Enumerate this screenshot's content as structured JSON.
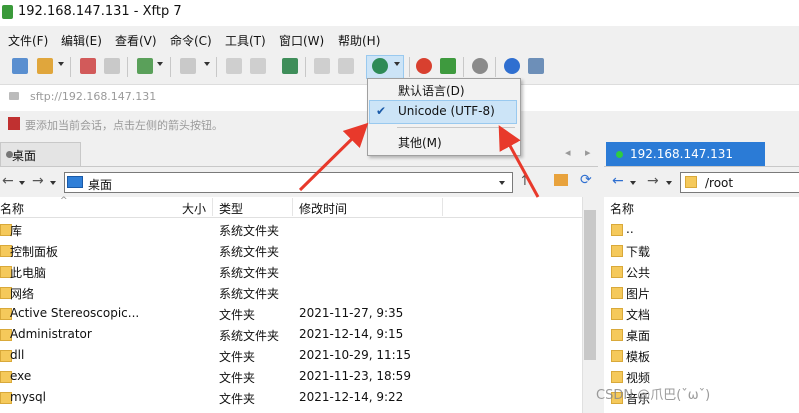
{
  "window": {
    "title": "192.168.147.131 - Xftp 7"
  },
  "menu": [
    "文件(F)",
    "编辑(E)",
    "查看(V)",
    "命令(C)",
    "工具(T)",
    "窗口(W)",
    "帮助(H)"
  ],
  "address": {
    "value": "sftp://192.168.147.131"
  },
  "hint": {
    "text": "要添加当前会话，点击左侧的箭头按钮。"
  },
  "encoding_menu": {
    "items": [
      {
        "label": "默认语言(D)",
        "checked": false
      },
      {
        "label": "Unicode (UTF-8)",
        "checked": true
      },
      {
        "label": "其他(M)",
        "checked": false
      }
    ],
    "check_glyph": "✔"
  },
  "left_panel": {
    "tab_label": "桌面",
    "path": "桌面",
    "columns": [
      "名称",
      "大小",
      "类型",
      "修改时间"
    ],
    "rows": [
      {
        "name": "库",
        "size": "",
        "type": "系统文件夹",
        "modified": ""
      },
      {
        "name": "控制面板",
        "size": "",
        "type": "系统文件夹",
        "modified": ""
      },
      {
        "name": "此电脑",
        "size": "",
        "type": "系统文件夹",
        "modified": ""
      },
      {
        "name": "网络",
        "size": "",
        "type": "系统文件夹",
        "modified": ""
      },
      {
        "name": "Active Stereoscopic...",
        "size": "",
        "type": "文件夹",
        "modified": "2021-11-27, 9:35"
      },
      {
        "name": "Administrator",
        "size": "",
        "type": "系统文件夹",
        "modified": "2021-12-14, 9:15"
      },
      {
        "name": "dll",
        "size": "",
        "type": "文件夹",
        "modified": "2021-10-29, 11:15"
      },
      {
        "name": "exe",
        "size": "",
        "type": "文件夹",
        "modified": "2021-11-23, 18:59"
      },
      {
        "name": "mysql",
        "size": "",
        "type": "文件夹",
        "modified": "2021-12-14, 9:22"
      }
    ],
    "sort_indicator": "^"
  },
  "right_panel": {
    "tab_label": "192.168.147.131",
    "path": "/root",
    "column": "名称",
    "rows": [
      "..",
      "下载",
      "公共",
      "图片",
      "文档",
      "桌面",
      "模板",
      "视频",
      "音乐"
    ]
  },
  "watermark": "CSDN @爪巴(ˇωˇ)",
  "colors": {
    "accent": "#2b7bd6",
    "arrow": "#e8392b",
    "highlight": "#cce4f7"
  }
}
